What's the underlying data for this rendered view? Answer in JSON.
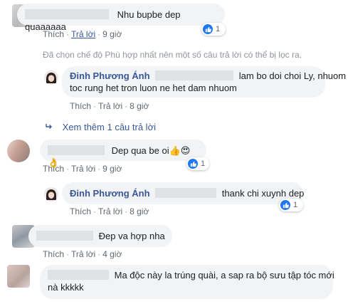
{
  "comments": [
    {
      "author": "",
      "text": "Nhu bupbe dep quaaaaaa",
      "like_label": "Thích",
      "reply_label": "Trả lời",
      "time": "9 giờ",
      "reaction_count": "1"
    },
    {
      "author": "Đinh Phương Ánh",
      "text_line1": "lam bo doi choi Ly, nhuom",
      "text_line2": "toc rung het tron luon ne het dam nhuom",
      "like_label": "Thích",
      "reply_label": "Trả lời",
      "time": "8 giờ"
    },
    {
      "author": "",
      "text": "Dep qua be oi",
      "emojis": "👍😍👌",
      "like_label": "Thích",
      "reply_label": "Trả lời",
      "time": "9 giờ",
      "reaction_count": "1"
    },
    {
      "author": "Đinh Phương Ánh",
      "text": "thank chi xuynh dep",
      "like_label": "Thích",
      "reply_label": "Trả lời",
      "time": "8 giờ",
      "reaction_count": "1"
    },
    {
      "author": "",
      "text": "Đep va hợp nha",
      "like_label": "Thích",
      "reply_label": "Trả lời",
      "time": "4 giờ"
    },
    {
      "author": "",
      "text_line1": "Ma độc này la trúng quài, a sap ra bộ sưu tập tóc mới",
      "text_line2": "nà kkkkk"
    }
  ],
  "filter_note": "Đã chọn chế độ Phù hợp nhất nên một số câu trả lời có thể bị lọc ra.",
  "more_replies": "Xem thêm 1 câu trả lời",
  "colors": {
    "link": "#385898",
    "bubble": "#f2f3f5",
    "like_blue": "#2078f4"
  }
}
